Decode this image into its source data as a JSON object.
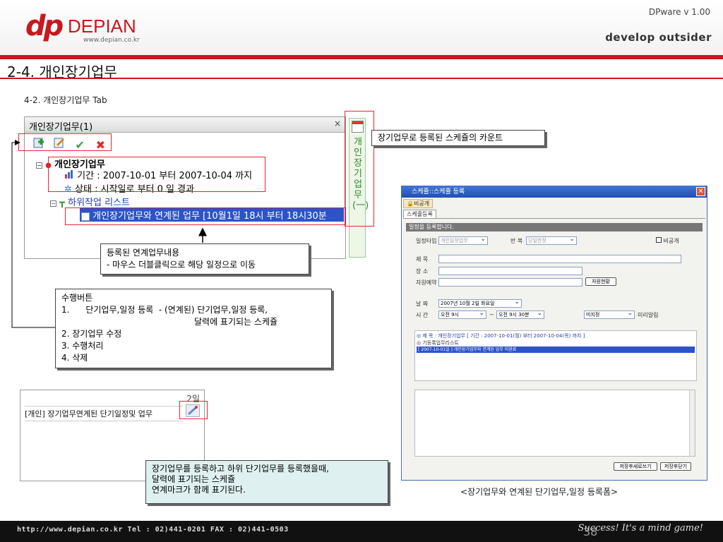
{
  "header": {
    "logo_dp": "dp",
    "logo_name": "DEPIAN",
    "logo_url": "www.depian.co.kr",
    "version": "DPware v 1.00",
    "tagline": "develop outsider"
  },
  "page_title": "2-4. 개인장기업무",
  "subtitle": "4-2. 개인장기업무 Tab",
  "tab_panel": {
    "title": "개인장기업무(1)",
    "close": "×",
    "tree": {
      "root_label": "개인장기업무",
      "period_label": "기간 : 2007-10-01 부터 2007-10-04 까지",
      "status_label": "상태 : 시작일로 부터 0 일 경과",
      "subtask_label": "하위작업 리스트",
      "linked_item": "개인장기업무와 연계된 업무 [10월1일 18시 부터 18시30분"
    },
    "side_text": "개인장기업무(一)"
  },
  "callouts": {
    "count": "장기업무로 등록된 스케쥴의 카운트",
    "linked_line1": "등록된 연계업무내용",
    "linked_line2": "- 마우스 더블클릭으로 해당 일정으로 이동",
    "buttons_title": "수행버튼",
    "buttons_item1": "1.      단기업무,일정 등록  - (연계된) 단기업무,일정 등록,",
    "buttons_item1b": "달력에 표기되는 스케쥴",
    "buttons_item2": "2. 장기업무 수정",
    "buttons_item3": "3. 수행처리",
    "buttons_item4": "4. 삭제",
    "calendar_line1": "장기업무를 등록하고 하위 단기업무를 등록했을때,",
    "calendar_line2": "달력에 표기되는 스케쥴",
    "calendar_line3": "연계마크가 함께 표기된다."
  },
  "calendar_cell": {
    "day": "2일",
    "entry": "[개인] 장기업무연계된 단기일정및 업무"
  },
  "dialog": {
    "title": "스케쥴::스케쥴 등록",
    "toolbar_btn": "비공개",
    "tab": "스케쥴등록",
    "section": "일정을 등록합니다.",
    "type_label": "일정타입",
    "type_value": "개인일정업무",
    "repeat_label": "반 복",
    "repeat_value": "당일한정",
    "private_label": "비공개",
    "subject_label": "제 목",
    "place_label": "장 소",
    "resource_label": "자원예약",
    "resource_btn": "자원현황",
    "date_label": "날 짜",
    "date_value": "2007년 10월  2일 화요일",
    "time_label": "시 간",
    "time_start": "오전 9시",
    "time_sep": "~",
    "time_end": "오전 9시 30분",
    "alarm_value": "미지정",
    "alarm_label": "미리알림",
    "linked_title": "◎ 제  목 : 개인장기업무 [ 기간 : 2007-10-01(월) 부터 2007-10-04(목) 까지 ]",
    "linked_list_label": "◎ 기등록업무리스트",
    "linked_list_item": "[ 2007-10-01일 ] 개인장기업무와 연계된 업무 미완료",
    "btn_save_new": "저장후새로쓰기",
    "btn_save_close": "저장후닫기"
  },
  "caption": "<장기업무와 연계된 단기업무,일정 등록폼>",
  "footer": {
    "contact": "http://www.depian.co.kr  Tel : 02)441-0201   FAX : 02)441-0503",
    "page_number": "38",
    "slogan": "Success! It's a mind game!"
  },
  "colors": {
    "brand_red": "#c8171e",
    "tree_blue": "#1a3fc0",
    "selection_blue": "#2c54c8"
  }
}
